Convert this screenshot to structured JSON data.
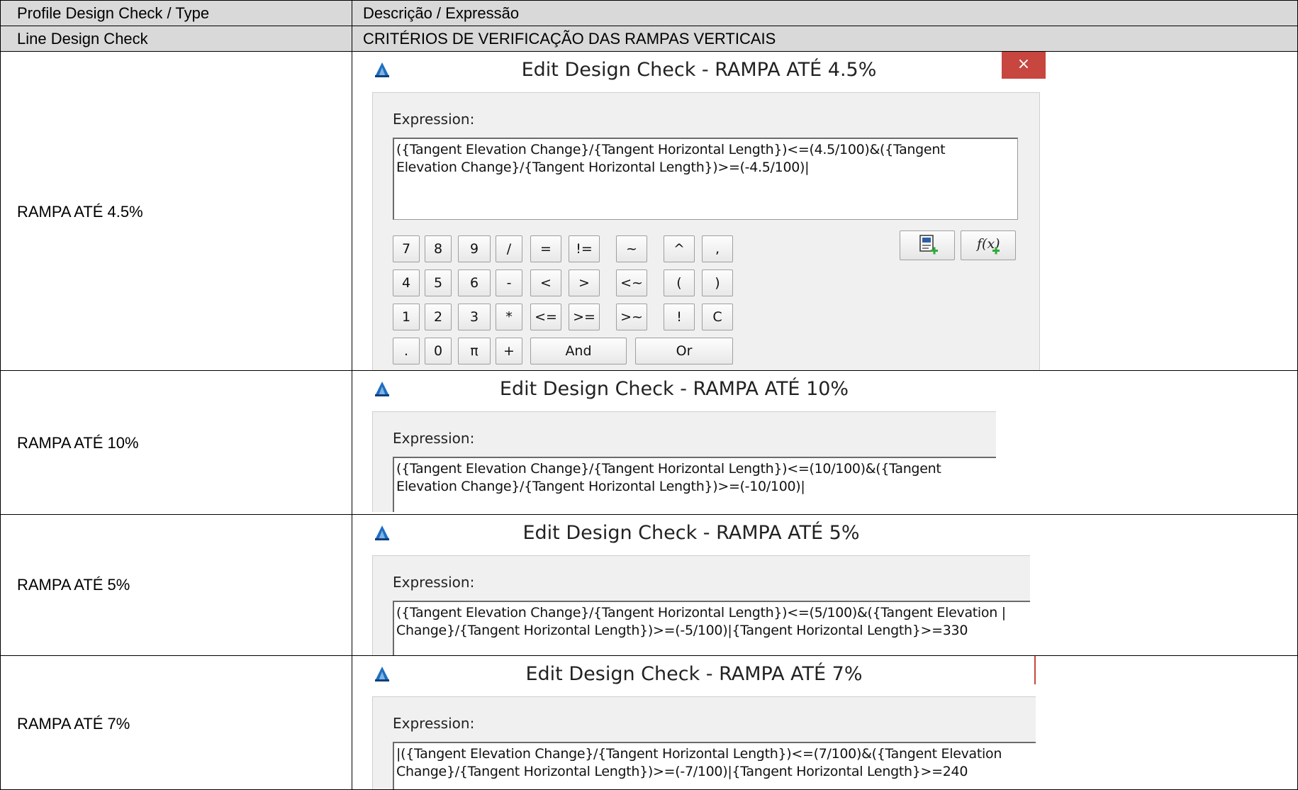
{
  "table": {
    "header": {
      "col1": "Profile Design Check / Type",
      "col2": "Descrição / Expressão"
    },
    "subheader": {
      "col1": "Line Design Check",
      "col2": "CRITÉRIOS DE VERIFICAÇÃO DAS RAMPAS VERTICAIS"
    },
    "rows": [
      {
        "label": "RAMPA ATÉ 4.5%",
        "dialog_title": "Edit Design Check - RAMPA ATÉ 4.5%",
        "expression_label": "Expression:",
        "expression": "({Tangent Elevation Change}/{Tangent Horizontal Length})<=(4.5/100)&({Tangent\nElevation Change}/{Tangent Horizontal Length})>=(-4.5/100)|"
      },
      {
        "label": "RAMPA ATÉ 10%",
        "dialog_title": "Edit Design Check - RAMPA ATÉ 10%",
        "expression_label": "Expression:",
        "expression": "({Tangent Elevation Change}/{Tangent Horizontal Length})<=(10/100)&({Tangent\nElevation Change}/{Tangent Horizontal Length})>=(-10/100)|"
      },
      {
        "label": "RAMPA ATÉ 5%",
        "dialog_title": "Edit Design Check - RAMPA ATÉ 5%",
        "expression_label": "Expression:",
        "expression": "({Tangent Elevation Change}/{Tangent Horizontal Length})<=(5/100)&({Tangent Elevation |\nChange}/{Tangent Horizontal Length})>=(-5/100)|{Tangent Horizontal Length}>=330"
      },
      {
        "label": "RAMPA ATÉ 7%",
        "dialog_title": "Edit Design Check - RAMPA ATÉ 7%",
        "expression_label": "Expression:",
        "expression": "|({Tangent Elevation Change}/{Tangent Horizontal Length})<=(7/100)&({Tangent Elevation\nChange}/{Tangent Horizontal Length})>=(-7/100)|{Tangent Horizontal Length}>=240"
      }
    ]
  },
  "dialog_controls": {
    "close_glyph": "×",
    "keypad": {
      "digits": [
        "7",
        "8",
        "9",
        "4",
        "5",
        "6",
        "1",
        "2",
        "3",
        ".",
        "0",
        "π"
      ],
      "ops_col": [
        "/",
        "-",
        "*",
        "+"
      ],
      "compare": [
        "=",
        "!=",
        "<",
        ">",
        "<=",
        ">="
      ],
      "similar": [
        "~",
        "<~",
        ">~"
      ],
      "misc": [
        "^",
        ",",
        "(",
        ")",
        "!",
        "C"
      ],
      "and_label": "And",
      "or_label": "Or"
    },
    "tool_icons": [
      "insert-property-icon",
      "insert-function-icon"
    ],
    "fx_glyph": "f(x)"
  },
  "colors": {
    "header_bg": "#d9d9d9",
    "close_button": "#c7463f",
    "logo_blue": "#1f6fbf"
  }
}
